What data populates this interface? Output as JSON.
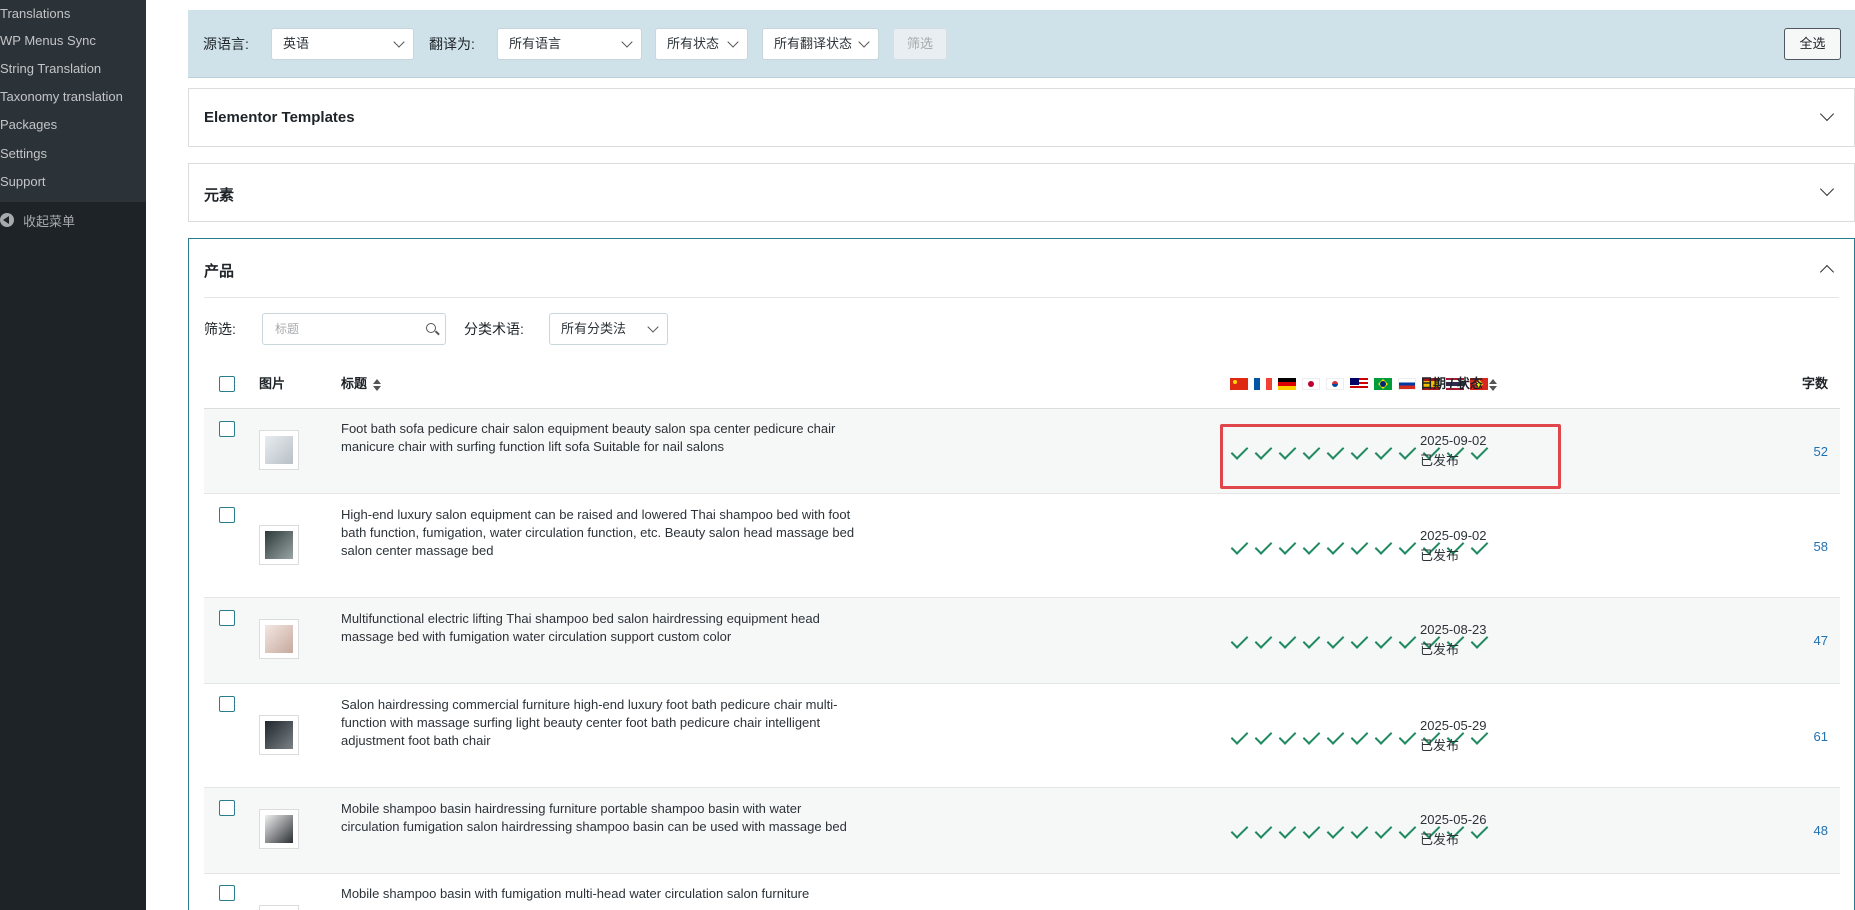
{
  "sidebar": {
    "items": [
      {
        "label": "Translations"
      },
      {
        "label": "WP Menus Sync"
      },
      {
        "label": "String Translation"
      },
      {
        "label": "Taxonomy translation"
      },
      {
        "label": "Packages"
      },
      {
        "label": "Settings"
      },
      {
        "label": "Support"
      }
    ],
    "collapse_label": "收起菜单"
  },
  "filterbar": {
    "source_label": "源语言:",
    "source_value": "英语",
    "translate_to_label": "翻译为:",
    "translate_to_value": "所有语言",
    "status_value": "所有状态",
    "translation_status_value": "所有翻译状态",
    "filter_button": "筛选",
    "select_all_button": "全选"
  },
  "panels": {
    "elementor": {
      "title": "Elementor Templates"
    },
    "elements": {
      "title": "元素"
    },
    "products": {
      "title": "产品",
      "filter_label": "筛选:",
      "search_placeholder": "标题",
      "taxonomy_label": "分类术语:",
      "taxonomy_value": "所有分类法"
    }
  },
  "table": {
    "headers": {
      "image": "图片",
      "title": "标题",
      "date_status": "日期 / 状态",
      "words": "字数"
    },
    "languages": [
      "zh-cn",
      "fr",
      "de",
      "ja",
      "ko",
      "ms",
      "pt-br",
      "ru",
      "es",
      "th",
      "vi"
    ],
    "rows": [
      {
        "title": "Foot bath sofa pedicure chair salon equipment beauty salon spa center pedicure chair manicure chair with surfing function lift sofa Suitable for nail salons",
        "date": "2025-09-02",
        "status": "已发布",
        "words": "52"
      },
      {
        "title": "High-end luxury salon equipment can be raised and lowered Thai shampoo bed with foot bath function, fumigation, water circulation function, etc. Beauty salon head massage bed salon center massage bed",
        "date": "2025-09-02",
        "status": "已发布",
        "words": "58"
      },
      {
        "title": "Multifunctional electric lifting Thai shampoo bed salon hairdressing equipment head massage bed with fumigation water circulation support custom color",
        "date": "2025-08-23",
        "status": "已发布",
        "words": "47"
      },
      {
        "title": "Salon hairdressing commercial furniture high-end luxury foot bath pedicure chair multi-function with massage surfing light beauty center foot bath pedicure chair intelligent adjustment foot bath chair",
        "date": "2025-05-29",
        "status": "已发布",
        "words": "61"
      },
      {
        "title": "Mobile shampoo basin hairdressing furniture portable shampoo basin with water circulation fumigation salon hairdressing shampoo basin can be used with massage bed",
        "date": "2025-05-26",
        "status": "已发布",
        "words": "48"
      },
      {
        "title": "Mobile shampoo basin with fumigation multi-head water circulation salon furniture",
        "date": "",
        "status": "",
        "words": ""
      }
    ]
  },
  "colors": {
    "accent": "#2a7d8c",
    "check": "#1f8a60",
    "link": "#2271b1",
    "highlight": "#e0474c"
  }
}
